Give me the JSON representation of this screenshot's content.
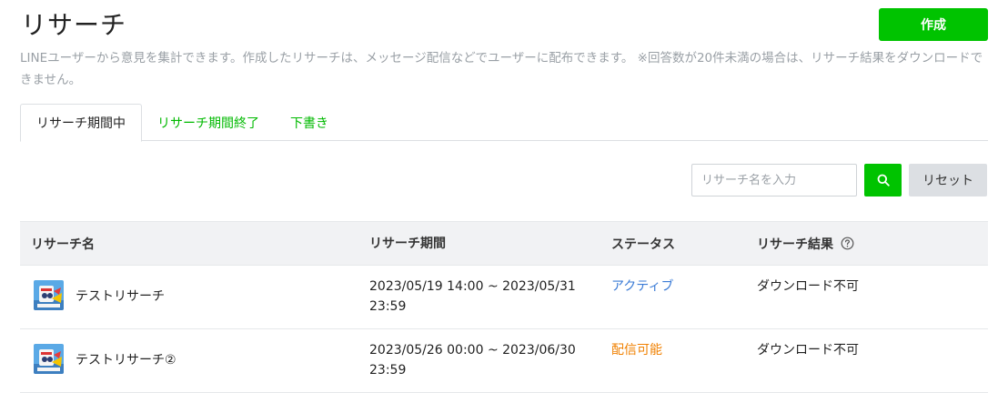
{
  "header": {
    "title": "リサーチ",
    "create_label": "作成",
    "description_main": "LINEユーザーから意見を集計できます。作成したリサーチは、メッセージ配信などでユーザーに配布できます。",
    "description_note": "※回答数が20件未満の場合は、リサーチ結果をダウンロードできません。"
  },
  "tabs": [
    {
      "label": "リサーチ期間中",
      "active": true
    },
    {
      "label": "リサーチ期間終了",
      "active": false
    },
    {
      "label": "下書き",
      "active": false
    }
  ],
  "search": {
    "placeholder": "リサーチ名を入力",
    "value": "",
    "reset_label": "リセット"
  },
  "table": {
    "columns": [
      "リサーチ名",
      "リサーチ期間",
      "ステータス",
      "リサーチ結果"
    ],
    "rows": [
      {
        "name": "テストリサーチ",
        "period_line1": "2023/05/19 14:00 ~ 2023/05/31",
        "period_line2": "23:59",
        "status": "アクティブ",
        "result": "ダウンロード不可"
      },
      {
        "name": "テストリサーチ②",
        "period_line1": "2023/05/26 00:00 ~ 2023/06/30",
        "period_line2": "23:59",
        "status": "配信可能",
        "result": "ダウンロード不可"
      }
    ]
  },
  "colors": {
    "accent": "#00c300",
    "link": "#00b900",
    "status_active": "#3b7bd6",
    "status_deliverable": "#f08000"
  },
  "icons": [
    "search-icon",
    "help-circle-icon",
    "thumbnail-image"
  ]
}
